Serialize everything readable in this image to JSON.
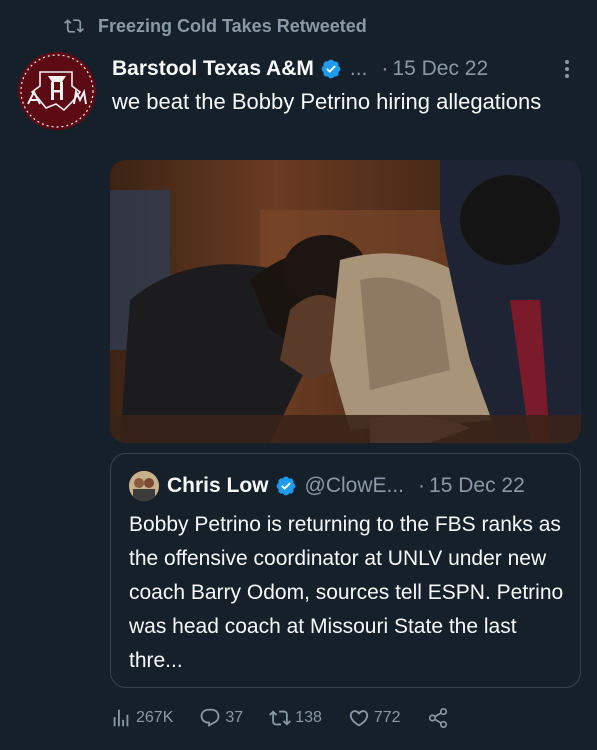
{
  "retweet": {
    "label": "Freezing Cold Takes Retweeted"
  },
  "tweet": {
    "author_name": "Barstool Texas A&M",
    "handle": "...",
    "date_sep": "·",
    "date": "15 Dec 22",
    "text": "we beat the Bobby Petrino hiring allegations"
  },
  "quote": {
    "author_name": "Chris Low",
    "handle": "@ClowE...",
    "date_sep": "·",
    "date": "15 Dec 22",
    "text": "Bobby Petrino is returning to the FBS ranks as the offensive coordinator at UNLV under new coach Barry Odom, sources tell ESPN. Petrino was head coach at Missouri State the last thre..."
  },
  "actions": {
    "views": "267K",
    "replies": "37",
    "retweets": "138",
    "likes": "772"
  },
  "colors": {
    "background": "#15202b",
    "muted": "#8b98a5",
    "verified": "#1d9bf0",
    "border": "#38444d"
  }
}
